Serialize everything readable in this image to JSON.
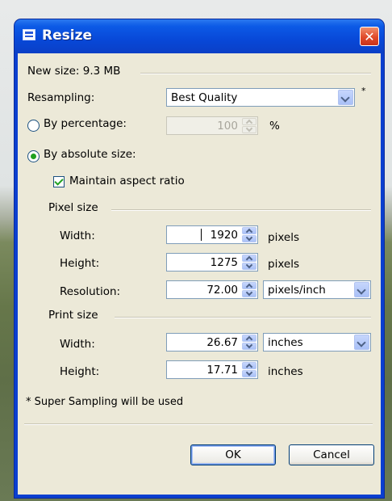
{
  "window": {
    "title": "Resize",
    "close_label": "✕"
  },
  "new_size": {
    "label": "New size: 9.3 MB"
  },
  "resampling": {
    "label": "Resampling:",
    "value": "Best Quality",
    "note_marker": "*"
  },
  "by_percentage": {
    "label": "By percentage:",
    "value": "100",
    "unit": "%",
    "selected": false
  },
  "by_absolute": {
    "label": "By absolute size:",
    "selected": true
  },
  "maintain_aspect": {
    "label": "Maintain aspect ratio",
    "checked": true
  },
  "pixel_size": {
    "heading": "Pixel size",
    "width": {
      "label": "Width:",
      "value": "1920",
      "unit": "pixels"
    },
    "height": {
      "label": "Height:",
      "value": "1275",
      "unit": "pixels"
    },
    "resolution": {
      "label": "Resolution:",
      "value": "72.00",
      "unit": "pixels/inch"
    }
  },
  "print_size": {
    "heading": "Print size",
    "width": {
      "label": "Width:",
      "value": "26.67",
      "unit": "inches"
    },
    "height": {
      "label": "Height:",
      "value": "17.71",
      "unit": "inches"
    }
  },
  "footnote": "* Super Sampling will be used",
  "buttons": {
    "ok": "OK",
    "cancel": "Cancel"
  },
  "colors": {
    "title_bar": "#0c5ae6",
    "dialog_bg": "#ece9d8",
    "close_button": "#e04a2a",
    "checked_mark": "#21a121"
  }
}
